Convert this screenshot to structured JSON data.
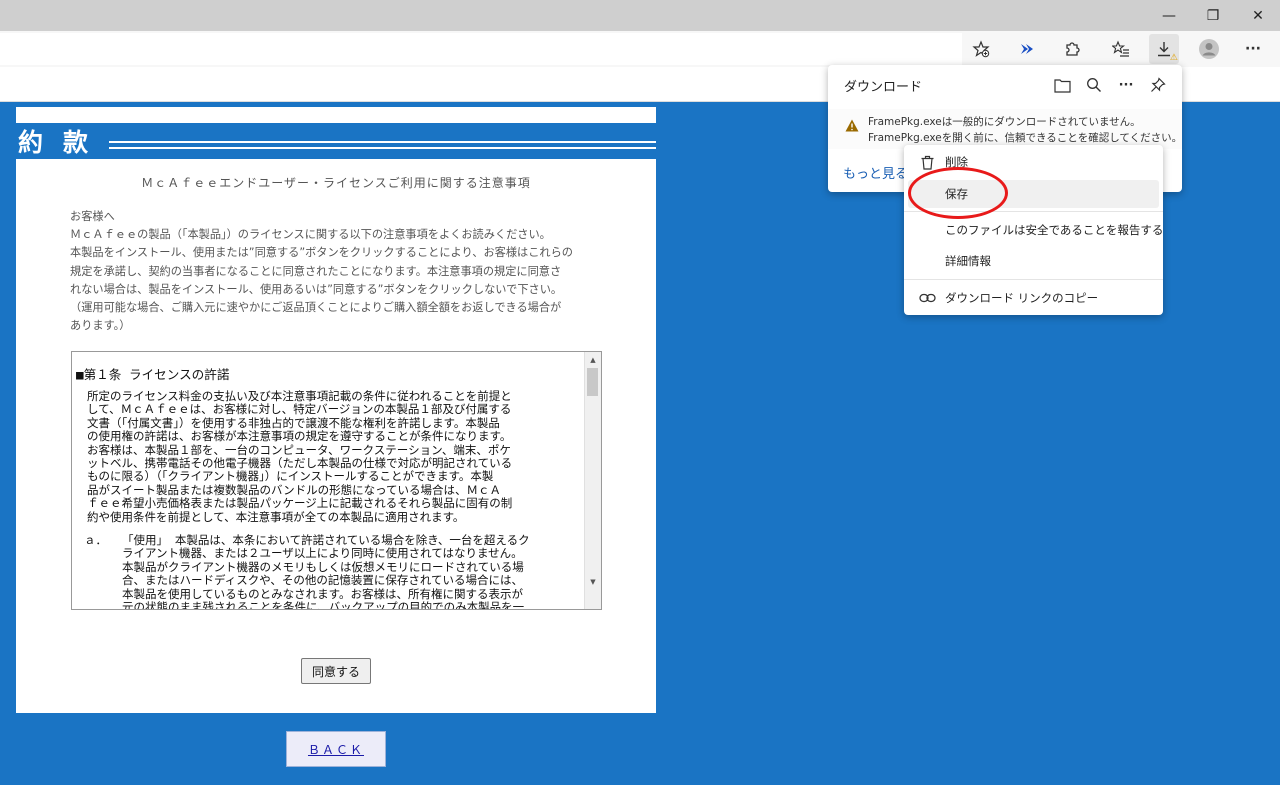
{
  "window": {
    "minimize_glyph": "—",
    "restore_glyph": "❐",
    "close_glyph": "✕"
  },
  "toolbar": {
    "more_glyph": "···",
    "download_warning_badge": "⚠"
  },
  "page": {
    "heading": "約款",
    "notice_title": "ＭｃＡｆｅｅエンドユーザー・ライセンスご利用に関する注意事項",
    "notice_lines": [
      "お客様へ",
      "ＭｃＡｆｅｅの製品（「本製品」）のライセンスに関する以下の注意事項をよくお読みください。",
      "本製品をインストール、使用または”同意する”ボタンをクリックすることにより、お客様はこれらの",
      "規定を承諾し、契約の当事者になることに同意されたことになります。本注意事項の規定に同意さ",
      "れない場合は、製品をインストール、使用あるいは”同意する”ボタンをクリックしないで下さい。",
      "（運用可能な場合、ご購入元に速やかにご返品頂くことによりご購入額全額をお返しできる場合が",
      "あります。）"
    ],
    "tos": {
      "section_title": "■第１条 ライセンスの許諾",
      "para_lines": [
        "所定のライセンス料金の支払い及び本注意事項記載の条件に従われることを前提と",
        "して、ＭｃＡｆｅｅは、お客様に対し、特定バージョンの本製品１部及び付属する",
        "文書（「付属文書」）を使用する非独占的で譲渡不能な権利を許諾します。本製品",
        "の使用権の許諾は、お客様が本注意事項の規定を遵守することが条件になります。",
        "お客様は、本製品１部を、一台のコンピュータ、ワークステーション、端末、ポケ",
        "ットベル、携帯電話その他電子機器（ただし本製品の仕様で対応が明記されている",
        "ものに限る）（「クライアント機器」）にインストールすることができます。本製",
        "品がスイート製品または複数製品のバンドルの形態になっている場合は、ＭｃＡ",
        "ｆｅｅ希望小売価格表または製品パッケージ上に記載されるそれら製品に固有の制",
        "約や使用条件を前提として、本注意事項が全ての本製品に適用されます。"
      ],
      "item_label": "ａ．",
      "item_lines": [
        "「使用」 本製品は、本条において許諾されている場合を除き、一台を超えるク",
        "ライアント機器、または２ユーザ以上により同時に使用されてはなりません。",
        "本製品がクライアント機器のメモリもしくは仮想メモリにロードされている場",
        "合、またはハードディスクや、その他の記憶装置に保存されている場合には、",
        "本製品を使用しているものとみなされます。お客様は、所有権に関する表示が",
        "元の状態のまま残されることを条件に、バックアップの目的でのみ本製品を一"
      ]
    },
    "agree_button": "同意する",
    "back_link": "ＢＡＣＫ"
  },
  "downloads": {
    "title": "ダウンロード",
    "line1": "FramePkg.exeは一般的にダウンロードされていません。",
    "line2": "FramePkg.exeを開く前に、信頼できることを確認してください。",
    "more": "もっと見る"
  },
  "context_menu": {
    "items": [
      "削除",
      "保存",
      "このファイルは安全であることを報告する",
      "詳細情報",
      "ダウンロード リンクのコピー"
    ],
    "highlighted": "保存"
  },
  "colors": {
    "page_bg": "#1a74c4",
    "highlight_circle": "#e81a1a",
    "link": "#1a5fb4"
  }
}
